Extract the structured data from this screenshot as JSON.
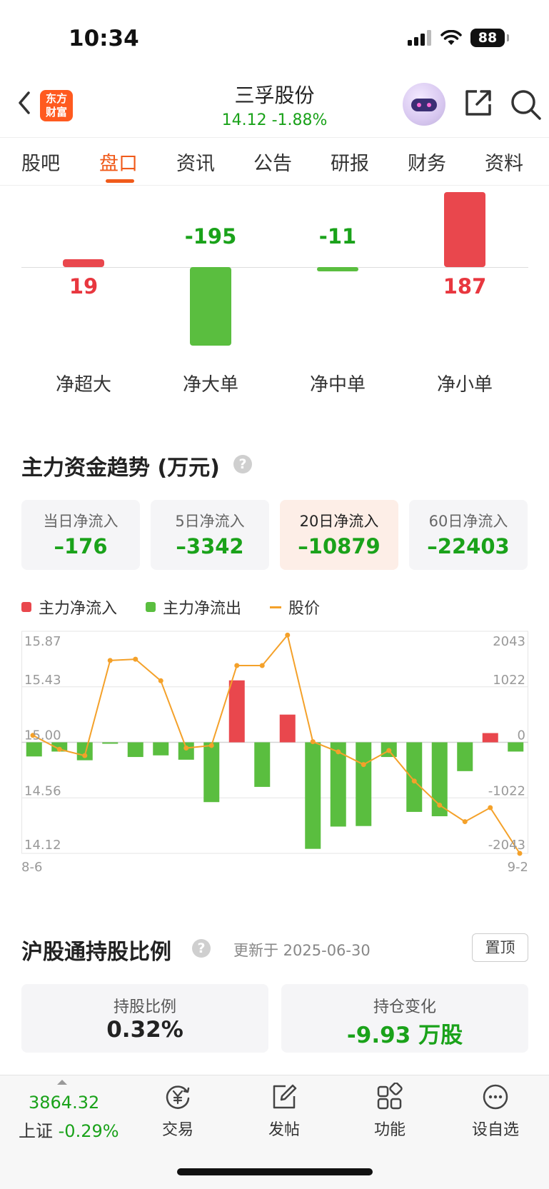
{
  "status_bar": {
    "time": "10:34",
    "battery": "88"
  },
  "header": {
    "logo_line1": "东方",
    "logo_line2": "财富",
    "stock_name": "三孚股份",
    "stock_price": "14.12  -1.88%"
  },
  "tabs": [
    {
      "label": "股吧",
      "active": false
    },
    {
      "label": "盘口",
      "active": true
    },
    {
      "label": "资讯",
      "active": false
    },
    {
      "label": "公告",
      "active": false
    },
    {
      "label": "研报",
      "active": false
    },
    {
      "label": "财务",
      "active": false
    },
    {
      "label": "资料",
      "active": false
    }
  ],
  "order_flow": [
    {
      "label": "净超大",
      "value": 19,
      "display": "19"
    },
    {
      "label": "净大单",
      "value": -195,
      "display": "-195"
    },
    {
      "label": "净中单",
      "value": -11,
      "display": "-11"
    },
    {
      "label": "净小单",
      "value": 187,
      "display": "187"
    }
  ],
  "trend": {
    "title": "主力资金趋势 (万元)",
    "cards": [
      {
        "label": "当日净流入",
        "value": "–176",
        "active": false
      },
      {
        "label": "5日净流入",
        "value": "–3342",
        "active": false
      },
      {
        "label": "20日净流入",
        "value": "–10879",
        "active": true
      },
      {
        "label": "60日净流入",
        "value": "–22403",
        "active": false
      }
    ],
    "legend": {
      "inflow": "主力净流入",
      "outflow": "主力净流出",
      "price": "股价"
    },
    "colors": {
      "inflow": "#e9474d",
      "outflow": "#5abe3f",
      "price": "#f4a12a"
    }
  },
  "chart_data": {
    "type": "bar",
    "x_start_label": "8-6",
    "x_end_label": "9-2",
    "left_ticks": [
      "15.87",
      "15.43",
      "15.00",
      "14.56",
      "14.12"
    ],
    "right_ticks": [
      "2043",
      "1022",
      "0",
      "-1022",
      "-2043"
    ],
    "price_range": [
      14.12,
      15.87
    ],
    "flow_range": [
      -2043,
      2043
    ],
    "grid": true,
    "series": [
      {
        "name": "主力净流入/净流出",
        "values": [
          -260,
          -170,
          -330,
          -15,
          -270,
          -240,
          -320,
          -1100,
          1140,
          -820,
          510,
          -1960,
          -1550,
          -1540,
          -270,
          -1280,
          -1360,
          -530,
          170,
          -170
        ]
      },
      {
        "name": "股价",
        "values": [
          15.05,
          14.94,
          14.89,
          15.64,
          15.65,
          15.48,
          14.95,
          14.97,
          15.6,
          15.6,
          15.84,
          15.0,
          14.92,
          14.82,
          14.93,
          14.69,
          14.5,
          14.37,
          14.48,
          14.12
        ]
      }
    ]
  },
  "hk_connect": {
    "title": "沪股通持股比例",
    "updated": "更新于 2025-06-30",
    "pin": "置顶",
    "ratio_label": "持股比例",
    "ratio_value": "0.32%",
    "change_label": "持仓变化",
    "change_value": "-9.93 万股"
  },
  "bottom_bar": {
    "index_value": "3864.32",
    "index_name": "上证",
    "index_change": "-0.29%",
    "nav": [
      {
        "label": "交易",
        "icon": "yen-exchange-icon"
      },
      {
        "label": "发帖",
        "icon": "edit-icon"
      },
      {
        "label": "功能",
        "icon": "grid-icon"
      },
      {
        "label": "设自选",
        "icon": "more-icon"
      }
    ]
  }
}
